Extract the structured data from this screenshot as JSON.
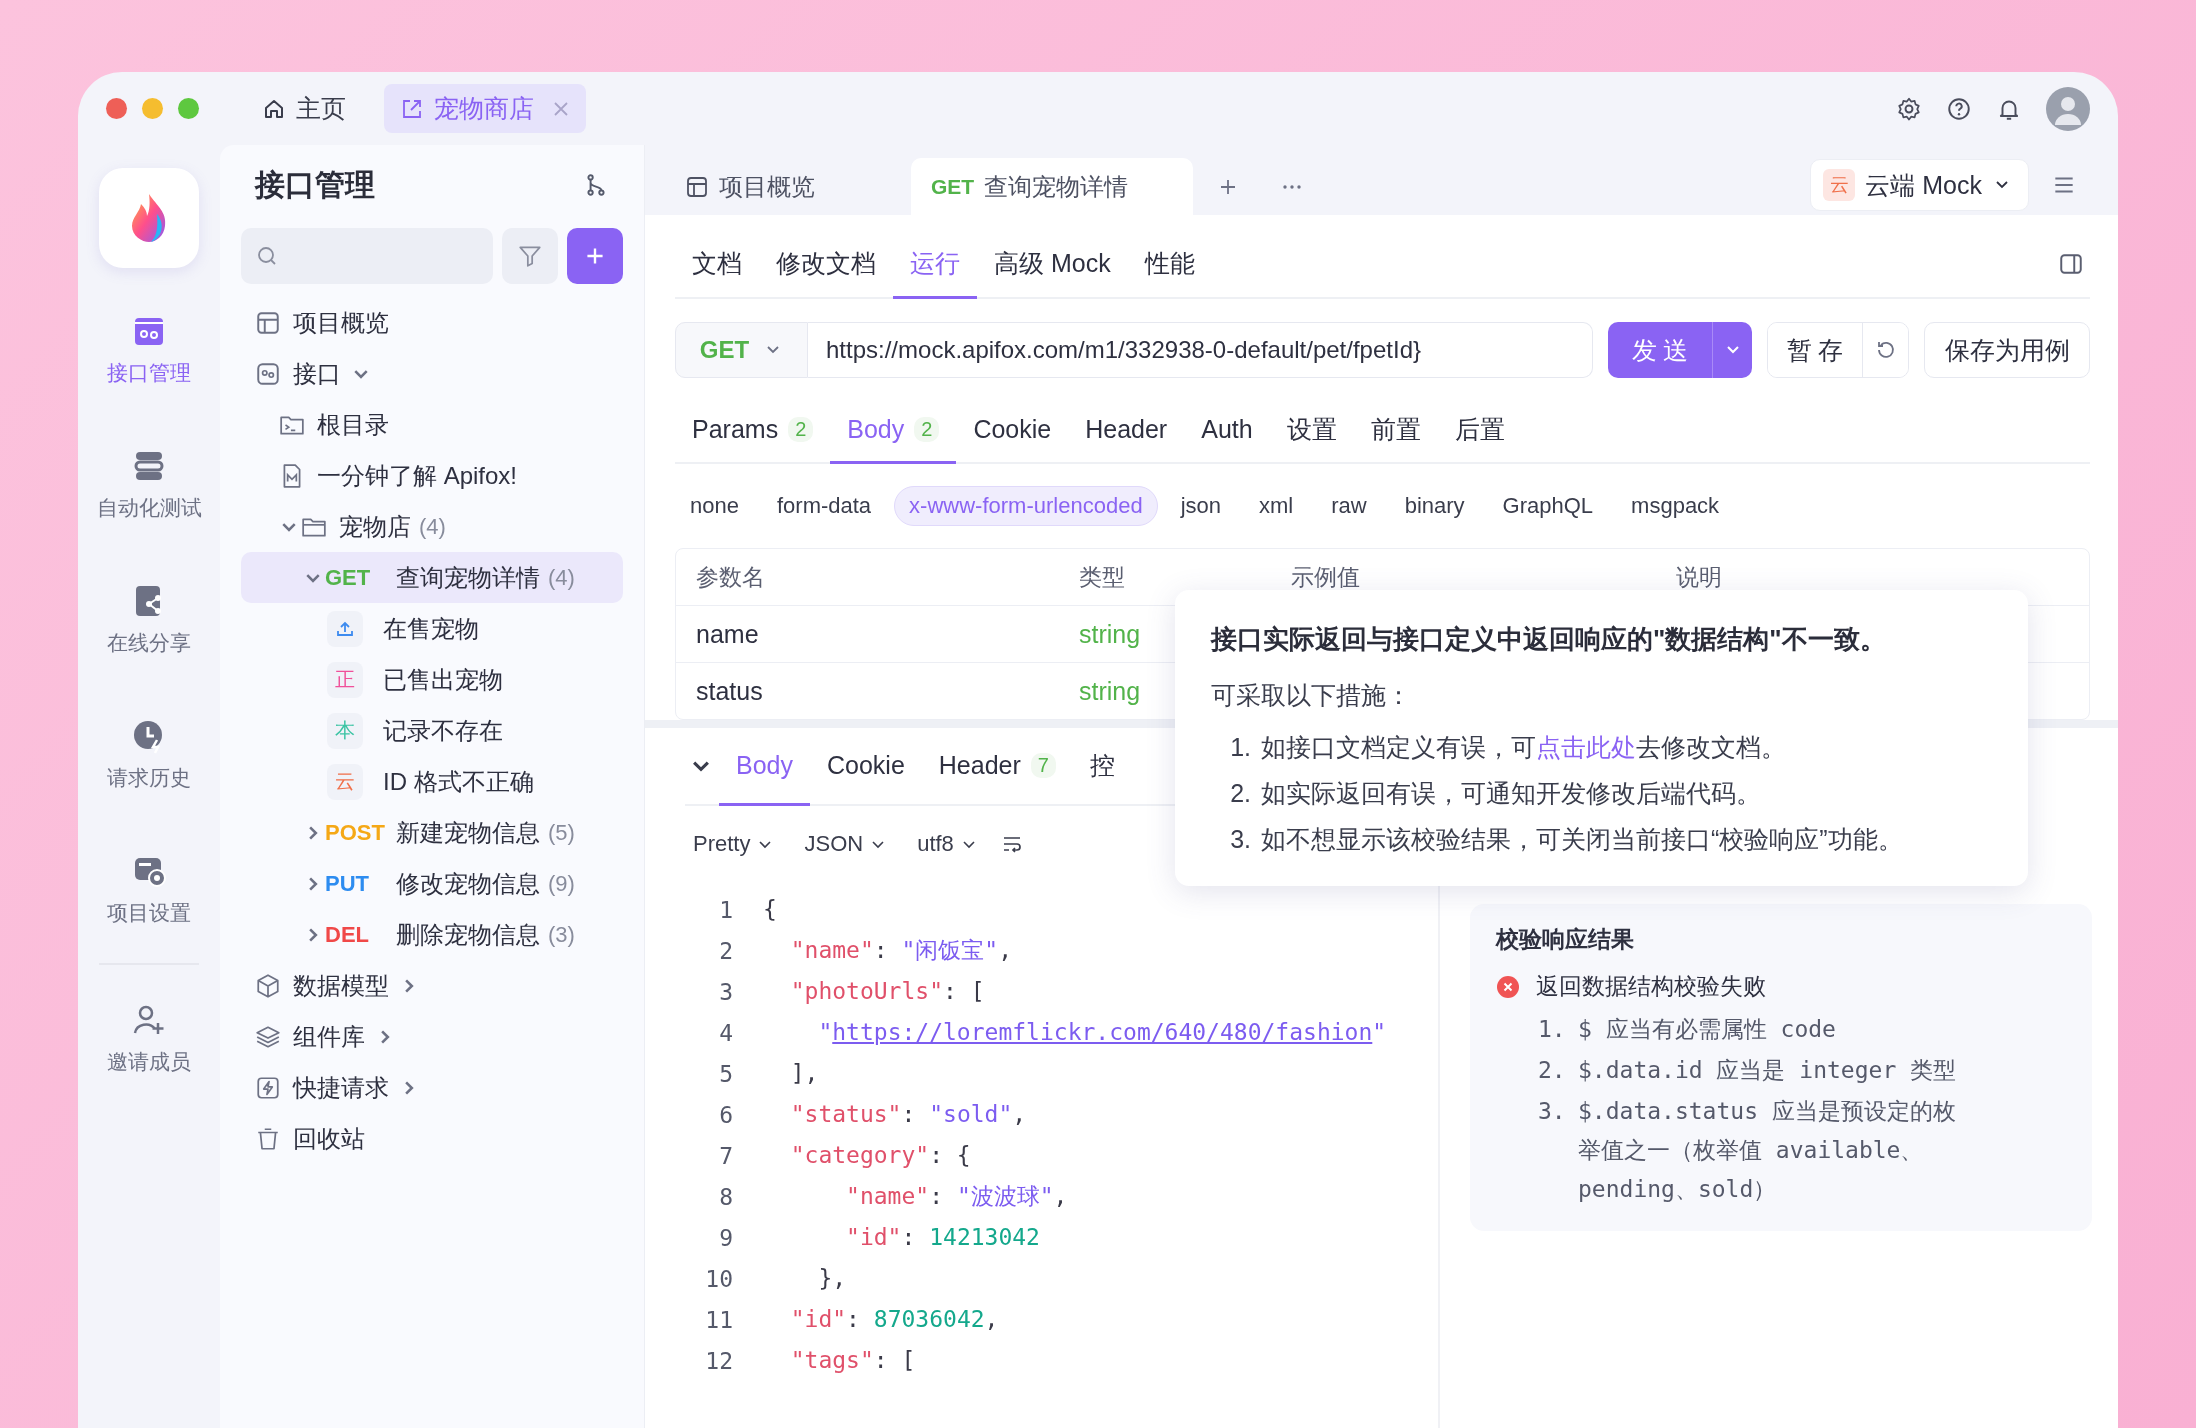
{
  "titlebar": {
    "tabs": [
      {
        "kind": "home",
        "label": "主页",
        "selected": false,
        "closable": false
      },
      {
        "kind": "project",
        "label": "宠物商店",
        "selected": true,
        "closable": true
      }
    ]
  },
  "rail": {
    "items": [
      {
        "kind": "api",
        "label": "接口管理",
        "selected": true
      },
      {
        "kind": "automation",
        "label": "自动化测试",
        "selected": false
      },
      {
        "kind": "share",
        "label": "在线分享",
        "selected": false
      },
      {
        "kind": "history",
        "label": "请求历史",
        "selected": false
      },
      {
        "kind": "settings",
        "label": "项目设置",
        "selected": false
      },
      {
        "kind": "invite",
        "label": "邀请成员",
        "selected": false
      }
    ]
  },
  "tree_panel": {
    "title": "接口管理",
    "items": [
      {
        "kind": "overview",
        "label": "项目概览",
        "selected": false
      },
      {
        "kind": "api-section",
        "label": "接口",
        "expanded": true,
        "selected": false,
        "children": [
          {
            "kind": "root-folder",
            "label": "根目录",
            "selected": false
          },
          {
            "kind": "markdown",
            "label": "一分钟了解 Apifox!",
            "selected": false
          },
          {
            "kind": "folder",
            "label": "宠物店",
            "count": "(4)",
            "expanded": true,
            "selected": false,
            "children": [
              {
                "kind": "endpoint",
                "method": "GET",
                "color": "#52b34a",
                "label": "查询宠物详情",
                "count": "(4)",
                "expanded": true,
                "selected": true,
                "children": [
                  {
                    "kind": "case",
                    "label": "在售宠物",
                    "color": "#3d8bef",
                    "selected": false
                  },
                  {
                    "kind": "case",
                    "badge": "正",
                    "label": "已售出宠物",
                    "color": "#f0509a",
                    "selected": false
                  },
                  {
                    "kind": "case",
                    "badge": "本",
                    "label": "记录不存在",
                    "color": "#3cc4a4",
                    "selected": false
                  },
                  {
                    "kind": "case",
                    "badge": "云",
                    "label": "ID 格式不正确",
                    "color": "#f0704a",
                    "selected": false
                  }
                ]
              },
              {
                "kind": "endpoint",
                "method": "POST",
                "color": "#f5a816",
                "label": "新建宠物信息",
                "count": "(5)",
                "expanded": false,
                "selected": false
              },
              {
                "kind": "endpoint",
                "method": "PUT",
                "color": "#2d8cf0",
                "label": "修改宠物信息",
                "count": "(9)",
                "expanded": false,
                "selected": false
              },
              {
                "kind": "endpoint",
                "method": "DEL",
                "color": "#f04848",
                "label": "删除宠物信息",
                "count": "(3)",
                "expanded": false,
                "selected": false
              }
            ]
          }
        ]
      },
      {
        "kind": "models",
        "label": "数据模型",
        "expanded": false,
        "selected": false
      },
      {
        "kind": "components",
        "label": "组件库",
        "expanded": false,
        "selected": false
      },
      {
        "kind": "quick",
        "label": "快捷请求",
        "expanded": false,
        "selected": false
      },
      {
        "kind": "trash",
        "label": "回收站",
        "selected": false
      }
    ]
  },
  "doc_tabs": [
    {
      "kind": "overview",
      "label": "项目概览",
      "selected": false
    },
    {
      "kind": "endpoint",
      "method": "GET",
      "color": "#52b34a",
      "label": "查询宠物详情",
      "selected": true
    }
  ],
  "mock_selector": {
    "badge": "云",
    "label": "云端 Mock"
  },
  "view_tabs": [
    {
      "label": "文档",
      "selected": false
    },
    {
      "label": "修改文档",
      "selected": false
    },
    {
      "label": "运行",
      "selected": true
    },
    {
      "label": "高级 Mock",
      "selected": false
    },
    {
      "label": "性能",
      "selected": false
    }
  ],
  "request": {
    "method": "GET",
    "url": "https://mock.apifox.com/m1/332938-0-default/pet/fpetId}",
    "send": "发 送",
    "save_draft": "暂 存",
    "save_case": "保存为用例"
  },
  "request_tabs": [
    {
      "label": "Params",
      "count": "2",
      "selected": false
    },
    {
      "label": "Body",
      "count": "2",
      "selected": true
    },
    {
      "label": "Cookie",
      "selected": false
    },
    {
      "label": "Header",
      "selected": false
    },
    {
      "label": "Auth",
      "selected": false
    },
    {
      "label": "设置",
      "selected": false
    },
    {
      "label": "前置",
      "selected": false
    },
    {
      "label": "后置",
      "selected": false
    }
  ],
  "body_types": [
    {
      "label": "none",
      "selected": false
    },
    {
      "label": "form-data",
      "selected": false
    },
    {
      "label": "x-www-form-urlencoded",
      "selected": true
    },
    {
      "label": "json",
      "selected": false
    },
    {
      "label": "xml",
      "selected": false
    },
    {
      "label": "raw",
      "selected": false
    },
    {
      "label": "binary",
      "selected": false
    },
    {
      "label": "GraphQL",
      "selected": false
    },
    {
      "label": "msgpack",
      "selected": false
    }
  ],
  "params_table": {
    "columns": [
      "参数名",
      "类型",
      "示例值",
      "说明"
    ],
    "rows": [
      {
        "name": "name",
        "type": "string"
      },
      {
        "name": "status",
        "type": "string"
      }
    ]
  },
  "response": {
    "expanded": true,
    "tabs": [
      {
        "label": "Body",
        "selected": true
      },
      {
        "label": "Cookie",
        "selected": false
      },
      {
        "label": "Header",
        "count": "7",
        "selected": false
      },
      {
        "label": "控",
        "selected": false
      }
    ],
    "format": [
      "Pretty",
      "JSON",
      "utf8"
    ],
    "code": [
      {
        "n": "1",
        "tokens": [
          {
            "kind": "punct",
            "text": "{"
          }
        ]
      },
      {
        "n": "2",
        "tokens": [
          {
            "kind": "key",
            "text": "  \"name\""
          },
          {
            "kind": "punct",
            "text": ": "
          },
          {
            "kind": "string",
            "text": "\"闲饭宝\""
          },
          {
            "kind": "punct",
            "text": ","
          }
        ]
      },
      {
        "n": "3",
        "tokens": [
          {
            "kind": "key",
            "text": "  \"photoUrls\""
          },
          {
            "kind": "punct",
            "text": ": ["
          }
        ]
      },
      {
        "n": "4",
        "tokens": [
          {
            "kind": "string",
            "text": "    \""
          },
          {
            "kind": "link",
            "text": "https://loremflickr.com/640/480/fashion"
          },
          {
            "kind": "string",
            "text": "\""
          }
        ]
      },
      {
        "n": "5",
        "tokens": [
          {
            "kind": "punct",
            "text": "  ],"
          }
        ]
      },
      {
        "n": "6",
        "tokens": [
          {
            "kind": "key",
            "text": "  \"status\""
          },
          {
            "kind": "punct",
            "text": ": "
          },
          {
            "kind": "string",
            "text": "\"sold\""
          },
          {
            "kind": "punct",
            "text": ","
          }
        ]
      },
      {
        "n": "7",
        "tokens": [
          {
            "kind": "key",
            "text": "  \"category\""
          },
          {
            "kind": "punct",
            "text": ": {"
          }
        ]
      },
      {
        "n": "8",
        "tokens": [
          {
            "kind": "key",
            "text": "      \"name\""
          },
          {
            "kind": "punct",
            "text": ": "
          },
          {
            "kind": "string",
            "text": "\"波波球\""
          },
          {
            "kind": "punct",
            "text": ","
          }
        ]
      },
      {
        "n": "9",
        "tokens": [
          {
            "kind": "key",
            "text": "      \"id\""
          },
          {
            "kind": "punct",
            "text": ": "
          },
          {
            "kind": "number",
            "text": "14213042"
          }
        ]
      },
      {
        "n": "10",
        "tokens": [
          {
            "kind": "punct",
            "text": "    },"
          }
        ]
      },
      {
        "n": "11",
        "tokens": [
          {
            "kind": "key",
            "text": "  \"id\""
          },
          {
            "kind": "punct",
            "text": ": "
          },
          {
            "kind": "number",
            "text": "87036042"
          },
          {
            "kind": "punct",
            "text": ","
          }
        ]
      },
      {
        "n": "12",
        "tokens": [
          {
            "kind": "key",
            "text": "  \"tags\""
          },
          {
            "kind": "punct",
            "text": ": ["
          }
        ]
      }
    ]
  },
  "validation": {
    "title": "校验响应结果",
    "error": "返回数据结构校验失败",
    "items": [
      {
        "n": "1.",
        "text": "$ 应当有必需属性 code"
      },
      {
        "n": "2.",
        "text": "$.data.id 应当是 integer 类型"
      },
      {
        "n": "3.",
        "text": "$.data.status 应当是预设定的枚举值之一（枚举值 available、pending、sold）"
      }
    ]
  },
  "tooltip": {
    "title": "接口实际返回与接口定义中返回响应的\"数据结构\"不一致。",
    "subtitle": "可采取以下措施：",
    "items": [
      {
        "n": "1.",
        "text": "如接口文档定义有误，可",
        "link": "点击此处",
        "after": "去修改文档。"
      },
      {
        "n": "2.",
        "text": "如实际返回有误，可通知开发修改后端代码。"
      },
      {
        "n": "3.",
        "text": "如不想显示该校验结果，可关闭当前接口“校验响应”功能。"
      }
    ]
  }
}
